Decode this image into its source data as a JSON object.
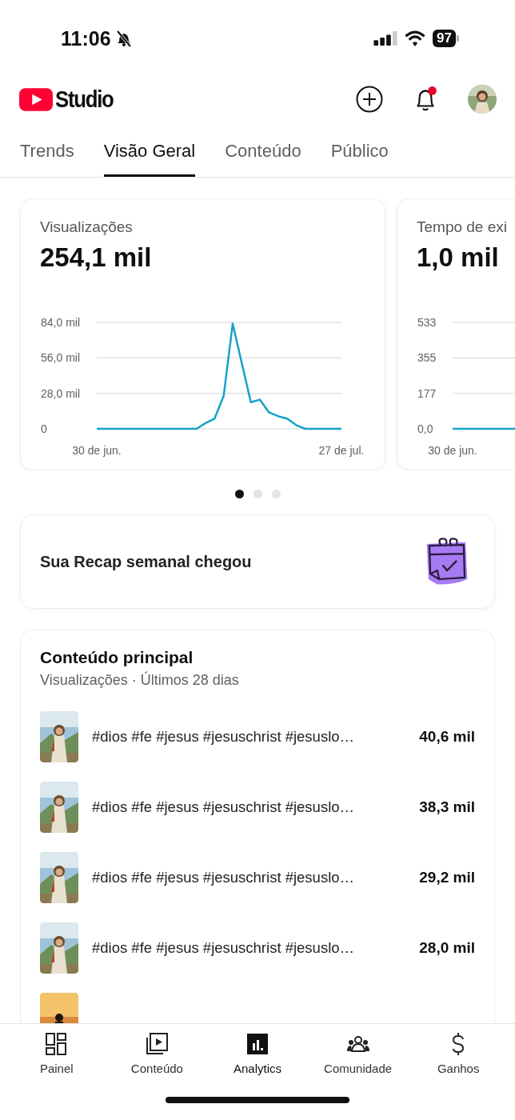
{
  "status_bar": {
    "time": "11:06",
    "battery": "97"
  },
  "header": {
    "logo_text": "Studio",
    "notification_unread": true
  },
  "tabs": [
    {
      "label": "Trends",
      "selected": false
    },
    {
      "label": "Visão Geral",
      "selected": true
    },
    {
      "label": "Conteúdo",
      "selected": false
    },
    {
      "label": "Público",
      "selected": false
    }
  ],
  "metric_cards": [
    {
      "title": "Visualizações",
      "value": "254,1 mil",
      "chart_data": {
        "type": "line",
        "categories": [
          "30 de jun.",
          null,
          null,
          null,
          null,
          null,
          null,
          null,
          null,
          null,
          null,
          null,
          null,
          null,
          null,
          null,
          null,
          null,
          null,
          null,
          null,
          null,
          null,
          null,
          null,
          null,
          null,
          "27 de jul."
        ],
        "series": [
          {
            "color": "#16a2c8",
            "values": [
              0,
              0,
              0,
              0,
              0,
              0,
              0,
              0,
              0,
              0,
              0,
              0,
              4.5,
              8,
              26,
              83,
              52,
              21,
              23,
              13,
              10,
              8,
              3,
              0,
              0,
              0,
              0,
              0
            ]
          }
        ],
        "ylim": [
          0,
          84
        ],
        "yticks": [
          {
            "value": 0,
            "label": "0"
          },
          {
            "value": 28,
            "label": "28,0 mil"
          },
          {
            "value": 56,
            "label": "56,0 mil"
          },
          {
            "value": 84,
            "label": "84,0 mil"
          }
        ]
      }
    },
    {
      "title": "Tempo de exi",
      "value": "1,0 mil",
      "chart_data": {
        "type": "line",
        "categories": [
          "30 de jun.",
          null,
          null,
          null,
          null,
          null,
          null,
          null,
          null,
          null,
          null,
          null,
          null,
          null,
          null,
          null,
          null,
          null,
          null,
          null,
          null,
          null,
          null,
          null,
          null,
          null,
          null,
          null
        ],
        "series": [
          {
            "color": "#16a2c8",
            "values": [
              0,
              0,
              0,
              0,
              0,
              0,
              0,
              null,
              null,
              null,
              null,
              null,
              null,
              null,
              null,
              null,
              null,
              null,
              null,
              null,
              null,
              null,
              null,
              null,
              null,
              null,
              null,
              null
            ]
          }
        ],
        "ylim": [
          0,
          533
        ],
        "yticks": [
          {
            "value": 0,
            "label": "0,0"
          },
          {
            "value": 177,
            "label": "177"
          },
          {
            "value": 355,
            "label": "355"
          },
          {
            "value": 533,
            "label": "533"
          }
        ]
      }
    }
  ],
  "pager": [
    {
      "selected": true
    },
    {
      "selected": false
    },
    {
      "selected": false
    }
  ],
  "recap": {
    "text": "Sua Recap semanal chegou"
  },
  "top_content": {
    "title": "Conteúdo principal",
    "subtitle": "Visualizações · Últimos 28 dias",
    "rows": [
      {
        "title": "#dios #fe #jesus #jesuschrist #jesuslo…",
        "views": "40,6 mil",
        "thumbnail": {
          "kind": "picture"
        }
      },
      {
        "title": "#dios #fe #jesus #jesuschrist #jesuslo…",
        "views": "38,3 mil",
        "thumbnail": {
          "kind": "picture"
        }
      },
      {
        "title": "#dios #fe #jesus #jesuschrist #jesuslo…",
        "views": "29,2 mil",
        "thumbnail": {
          "kind": "picture"
        }
      },
      {
        "title": "#dios #fe #jesus #jesuschrist #jesuslo…",
        "views": "28,0 mil",
        "thumbnail": {
          "kind": "picture"
        }
      },
      {
        "thumbnail": {
          "kind": "picture"
        }
      }
    ]
  },
  "bottom_nav": [
    {
      "label": "Painel",
      "kind": "dashboard",
      "selected": false
    },
    {
      "label": "Conteúdo",
      "kind": "content",
      "selected": false
    },
    {
      "label": "Analytics",
      "kind": "analytics",
      "selected": true
    },
    {
      "label": "Comunidade",
      "kind": "community",
      "selected": false
    },
    {
      "label": "Ganhos",
      "kind": "earnings",
      "selected": false
    }
  ]
}
